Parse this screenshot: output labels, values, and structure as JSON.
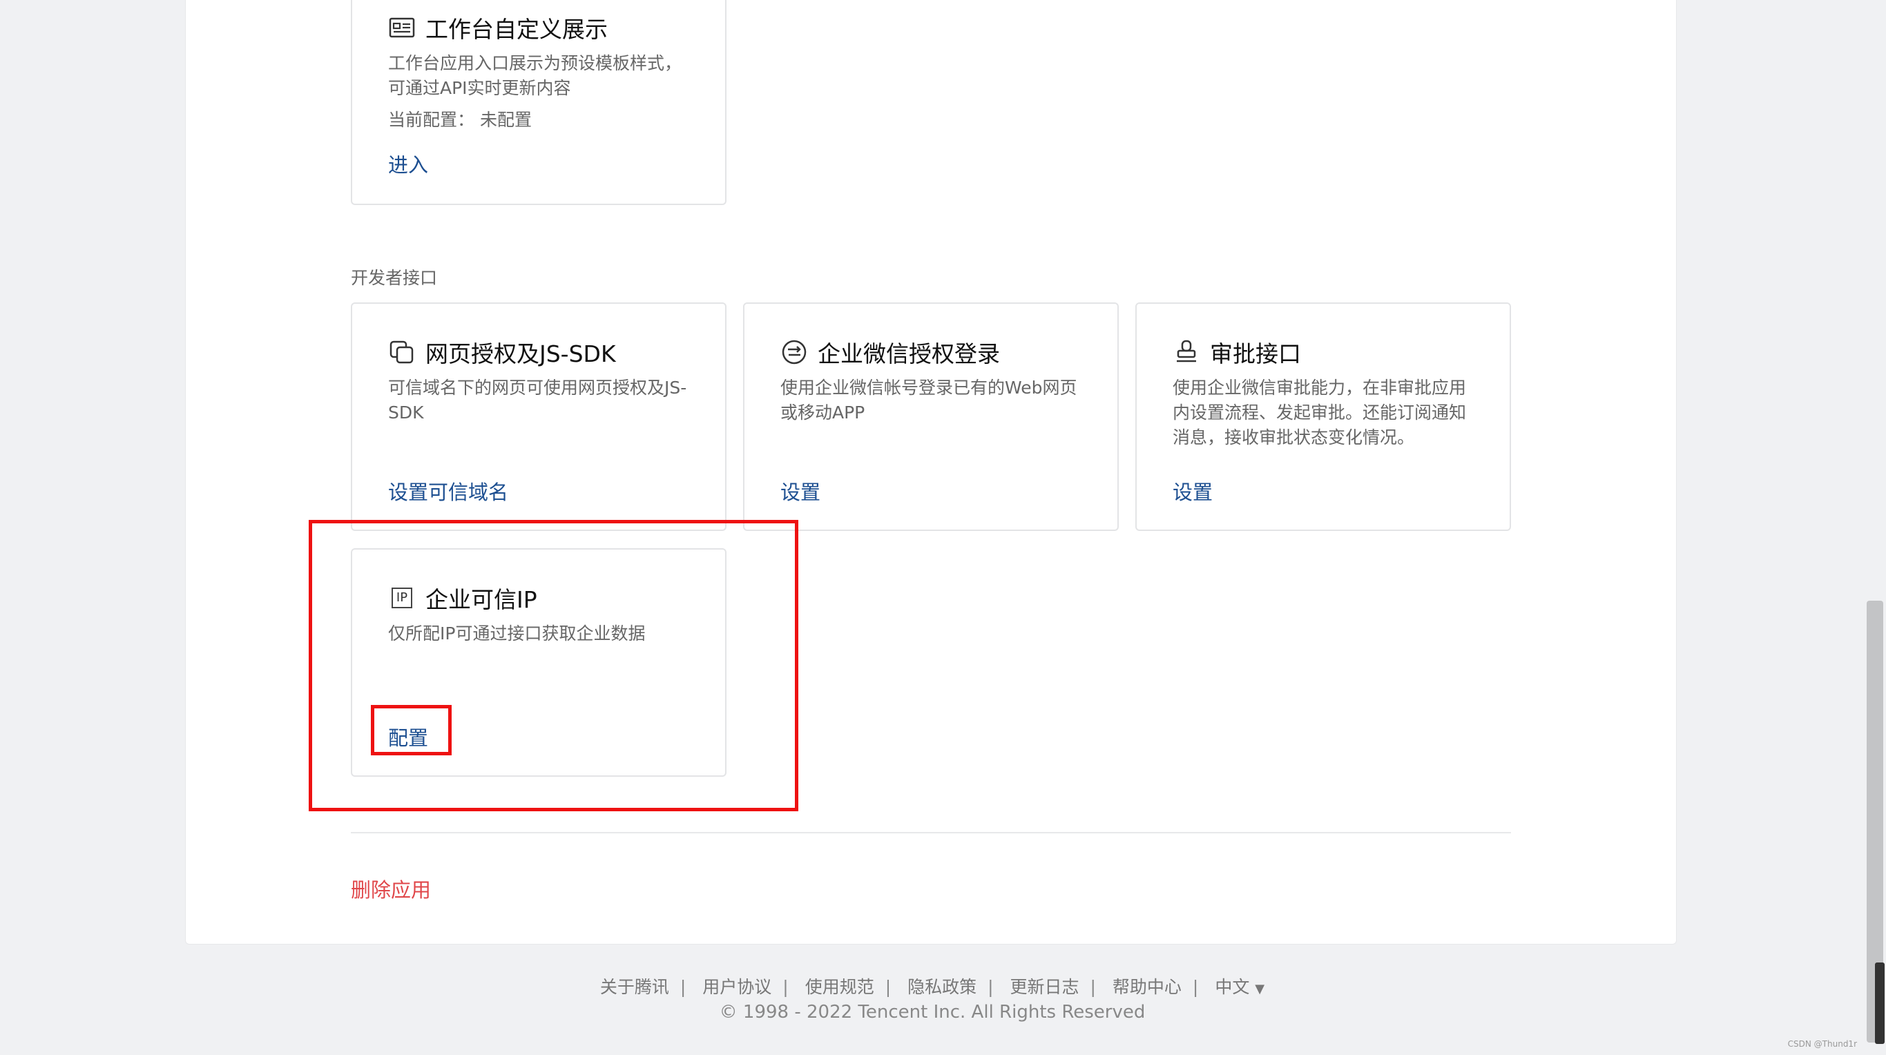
{
  "workbench_card": {
    "title": "工作台自定义展示",
    "desc": "工作台应用入口展示为预设模板样式，可通过API实时更新内容",
    "current_label": "当前配置：",
    "current_value": "未配置",
    "link": "进入"
  },
  "section": {
    "title": "开发者接口"
  },
  "cards": [
    {
      "title": "网页授权及JS-SDK",
      "desc": "可信域名下的网页可使用网页授权及JS-SDK",
      "link": "设置可信域名"
    },
    {
      "title": "企业微信授权登录",
      "desc": "使用企业微信帐号登录已有的Web网页或移动APP",
      "link": "设置"
    },
    {
      "title": "审批接口",
      "desc": "使用企业微信审批能力，在非审批应用内设置流程、发起审批。还能订阅通知消息，接收审批状态变化情况。",
      "link": "设置"
    },
    {
      "title": "企业可信IP",
      "desc": "仅所配IP可通过接口获取企业数据",
      "link": "配置",
      "icon_text": "IP"
    }
  ],
  "delete_app": "删除应用",
  "footer": {
    "links": [
      "关于腾讯",
      "用户协议",
      "使用规范",
      "隐私政策",
      "更新日志",
      "帮助中心"
    ],
    "language": "中文",
    "language_caret": "▼",
    "separator": "|",
    "copyright": "© 1998 - 2022 Tencent Inc. All Rights Reserved"
  },
  "watermark": "CSDN @Thund1r",
  "colors": {
    "link": "#1d4f91",
    "danger": "#e0474a",
    "highlight": "#ee1111"
  },
  "icons": [
    "workbench-card-icon",
    "web-auth-icon",
    "wework-login-icon",
    "approval-stamp-icon",
    "ip-icon"
  ]
}
